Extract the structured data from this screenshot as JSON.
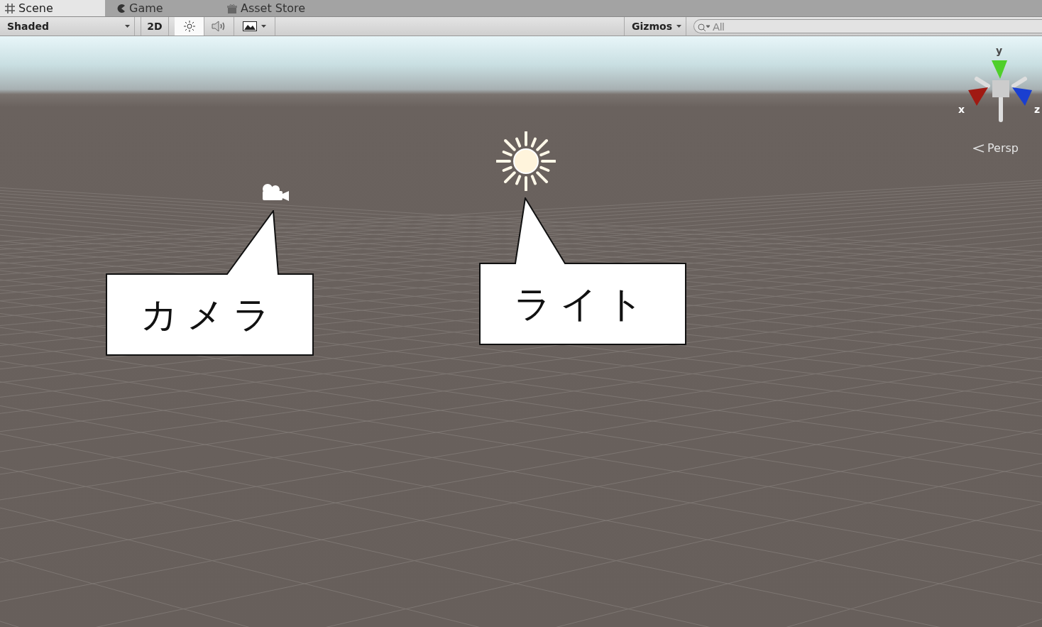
{
  "tabs": [
    {
      "label": "Scene",
      "selected": true,
      "kind": "grid"
    },
    {
      "label": "Game",
      "selected": false,
      "kind": "pacman"
    },
    {
      "label": "Asset Store",
      "selected": false,
      "kind": "bag"
    }
  ],
  "toolbar": {
    "shading": "Shaded",
    "mode_2d": {
      "label": "2D",
      "selected": false
    },
    "toggles": [
      {
        "kind": "light",
        "selected": true
      },
      {
        "kind": "audio",
        "selected": false
      },
      {
        "kind": "effects",
        "selected": false
      }
    ],
    "gizmos": "Gizmos",
    "search": {
      "placeholder": "All"
    }
  },
  "scene": {
    "axes": {
      "y": "y",
      "x": "x",
      "z": "z"
    },
    "projection": "Persp",
    "objects": [
      {
        "kind": "camera",
        "callout": "カメラ"
      },
      {
        "kind": "light",
        "callout": "ライト"
      }
    ]
  }
}
